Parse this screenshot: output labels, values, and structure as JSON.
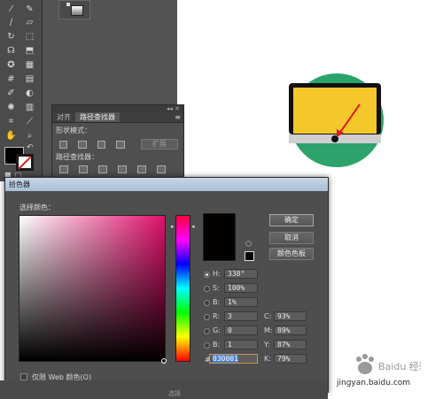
{
  "pathfinder_panel": {
    "tabs": [
      "对齐",
      "路径查找器"
    ],
    "menu_glyph": "≡",
    "shape_modes_label": "形状模式：",
    "pathfinders_label": "路径查找器：",
    "expand_label": "扩展"
  },
  "color_picker": {
    "title": "拾色器",
    "select_color_label": "选择颜色：",
    "buttons": {
      "ok": "确定",
      "cancel": "取消",
      "swatches": "颜色色板"
    },
    "hsb": [
      {
        "label": "H:",
        "value": "338°"
      },
      {
        "label": "S:",
        "value": "100%"
      },
      {
        "label": "B:",
        "value": "1%"
      }
    ],
    "rgb": [
      {
        "label": "R:",
        "value": "3"
      },
      {
        "label": "G:",
        "value": "0"
      },
      {
        "label": "B:",
        "value": "1"
      }
    ],
    "cmyk": [
      {
        "label": "C:",
        "value": "93%"
      },
      {
        "label": "M:",
        "value": "89%"
      },
      {
        "label": "Y:",
        "value": "87%"
      },
      {
        "label": "K:",
        "value": "79%"
      }
    ],
    "hex_label": "#",
    "hex_value": "030001",
    "web_only_label": "仅限 Web 颜色(O)",
    "new_color": "#030001",
    "hue_color": "#e0106a"
  },
  "colors": {
    "screen_yellow": "#f4c82b",
    "circle_green": "#2ca36a",
    "arrow_red": "#e01a1a",
    "dialog_bg": "#4e4e4e"
  },
  "bottom_strip_text": "选择",
  "watermark": {
    "site": "Baidu 经验",
    "url": "jingyan.baidu.com"
  }
}
